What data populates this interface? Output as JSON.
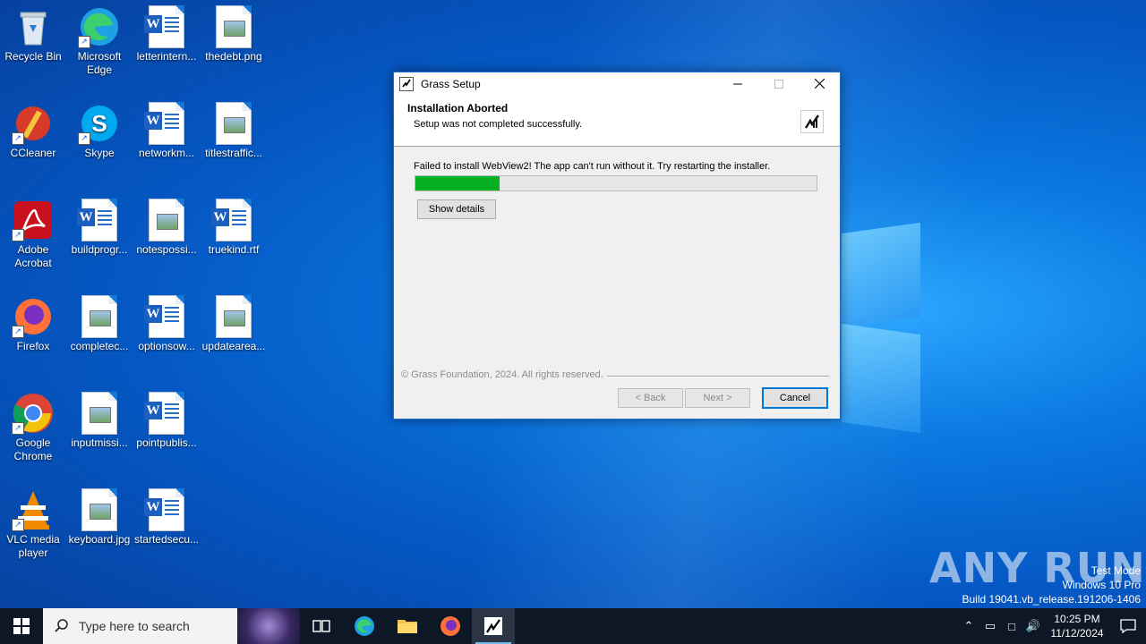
{
  "desktop": {
    "icons": [
      {
        "label": "Recycle Bin",
        "type": "recycle"
      },
      {
        "label": "Microsoft Edge",
        "type": "edge"
      },
      {
        "label": "letterintern...",
        "type": "word"
      },
      {
        "label": "thedebt.png",
        "type": "image"
      },
      {
        "label": "CCleaner",
        "type": "ccleaner"
      },
      {
        "label": "Skype",
        "type": "skype"
      },
      {
        "label": "networkm...",
        "type": "word"
      },
      {
        "label": "titlestraffic...",
        "type": "image"
      },
      {
        "label": "Adobe Acrobat",
        "type": "acrobat"
      },
      {
        "label": "buildprogr...",
        "type": "word"
      },
      {
        "label": "notespossi...",
        "type": "image"
      },
      {
        "label": "truekind.rtf",
        "type": "word"
      },
      {
        "label": "Firefox",
        "type": "firefox"
      },
      {
        "label": "completec...",
        "type": "image"
      },
      {
        "label": "optionsow...",
        "type": "word"
      },
      {
        "label": "updatearea...",
        "type": "image"
      },
      {
        "label": "Google Chrome",
        "type": "chrome"
      },
      {
        "label": "inputmissi...",
        "type": "image"
      },
      {
        "label": "pointpublis...",
        "type": "word"
      },
      {
        "label": "VLC media player",
        "type": "vlc"
      },
      {
        "label": "keyboard.jpg",
        "type": "image"
      },
      {
        "label": "startedsecu...",
        "type": "word"
      }
    ]
  },
  "dialog": {
    "window_title": "Grass Setup",
    "header_title": "Installation Aborted",
    "header_subtitle": "Setup was not completed successfully.",
    "message": "Failed to install WebView2! The app can't run without it. Try restarting the installer.",
    "progress_fraction": 0.21,
    "progress_color": "#06b025",
    "show_details_label": "Show details",
    "branding": "© Grass Foundation, 2024. All rights reserved.",
    "back_label": "< Back",
    "next_label": "Next >",
    "cancel_label": "Cancel"
  },
  "taskbar": {
    "search_placeholder": "Type here to search",
    "apps": [
      "task-view",
      "edge",
      "file-explorer",
      "firefox",
      "grass-setup"
    ],
    "time": "10:25 PM",
    "date": "11/12/2024"
  },
  "watermark": {
    "line1": "Test Mode",
    "line2": "Windows 10 Pro",
    "line3": "Build 19041.vb_release.191206-1406",
    "brand": "ANY RUN"
  }
}
